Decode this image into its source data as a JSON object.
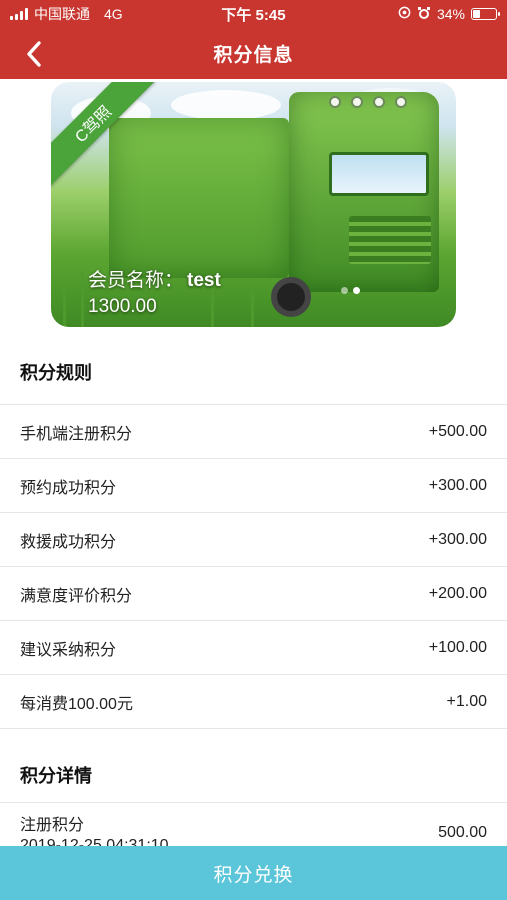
{
  "status_bar": {
    "carrier": "中国联通",
    "network": "4G",
    "time": "下午 5:45",
    "battery": "34%",
    "battery_level": 0.34
  },
  "nav": {
    "title": "积分信息",
    "back_icon": "chevron-left-icon"
  },
  "card": {
    "ribbon": "C驾照",
    "member_label": "会员名称：",
    "member_name": "test",
    "points": "1300.00",
    "carousel_pages": 2,
    "carousel_active": 1
  },
  "rules": {
    "title": "积分规则",
    "items": [
      {
        "label": "手机端注册积分",
        "value": "+500.00"
      },
      {
        "label": "预约成功积分",
        "value": "+300.00"
      },
      {
        "label": "救援成功积分",
        "value": "+300.00"
      },
      {
        "label": "满意度评价积分",
        "value": "+200.00"
      },
      {
        "label": "建议采纳积分",
        "value": "+100.00"
      },
      {
        "label": "每消费100.00元",
        "value": "+1.00"
      }
    ]
  },
  "details": {
    "title": "积分详情",
    "items": [
      {
        "label": "注册积分",
        "time": "2019-12-25 04:31:10",
        "amount": "500.00"
      }
    ]
  },
  "bottom_button": {
    "label": "积分兑换",
    "color": "#5bc5d9"
  },
  "theme": {
    "header_color": "#c8362f",
    "ribbon_color": "#4aa43a"
  }
}
